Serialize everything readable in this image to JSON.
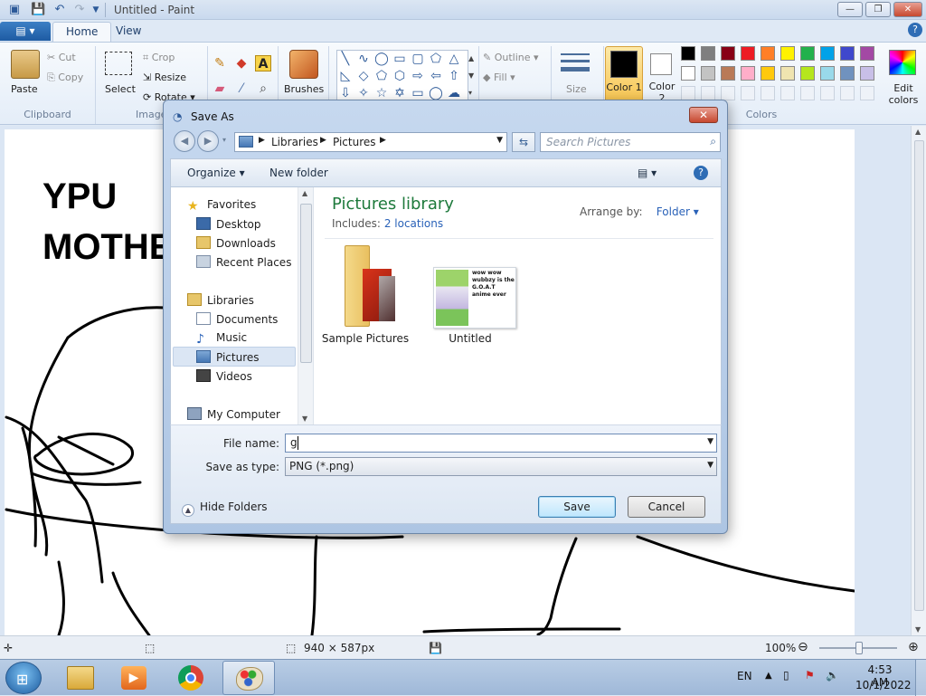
{
  "app": {
    "title": "Untitled - Paint",
    "tabs": {
      "file": "",
      "home": "Home",
      "view": "View"
    }
  },
  "ribbon": {
    "clipboard": {
      "paste": "Paste",
      "cut": "Cut",
      "copy": "Copy",
      "group": "Clipboard"
    },
    "image": {
      "select": "Select",
      "crop": "Crop",
      "resize": "Resize",
      "rotate": "Rotate",
      "group": "Image"
    },
    "tools": {
      "brushes": "Brushes"
    },
    "shapes": {
      "outline": "Outline",
      "fill": "Fill"
    },
    "size": "Size",
    "color1": "Color 1",
    "color2": "Color 2",
    "edit_colors": "Edit colors",
    "colors_group": "Colors",
    "palette_row1": [
      "#000000",
      "#7f7f7f",
      "#880015",
      "#ed1c24",
      "#ff7f27",
      "#fff200",
      "#22b14c",
      "#00a2e8",
      "#3f48cc",
      "#a349a4"
    ],
    "palette_row2": [
      "#ffffff",
      "#c3c3c3",
      "#b97a57",
      "#ffaec9",
      "#ffc90e",
      "#efe4b0",
      "#b5e61d",
      "#99d9ea",
      "#7092be",
      "#c8bfe7"
    ]
  },
  "canvas": {
    "text_line1": "YPU",
    "text_line2": "MOTHE"
  },
  "statusbar": {
    "dimensions": "940 × 587px",
    "zoom": "100%"
  },
  "dialog": {
    "title": "Save As",
    "breadcrumb": [
      "Libraries",
      "Pictures"
    ],
    "search_placeholder": "Search Pictures",
    "organize": "Organize",
    "new_folder": "New folder",
    "nav": {
      "favorites": "Favorites",
      "desktop": "Desktop",
      "downloads": "Downloads",
      "recent_places": "Recent Places",
      "libraries": "Libraries",
      "documents": "Documents",
      "music": "Music",
      "pictures": "Pictures",
      "videos": "Videos",
      "my_computer": "My Computer"
    },
    "library_title": "Pictures library",
    "includes_label": "Includes:",
    "includes_link": "2 locations",
    "arrange_by": "Arrange by:",
    "arrange_value": "Folder",
    "items": [
      {
        "label": "Sample Pictures"
      },
      {
        "label": "Untitled",
        "thumb_text": "wow wow wubbzy is the G.O.A.T anime ever"
      }
    ],
    "file_name_label": "File name:",
    "file_name_value": "g",
    "save_type_label": "Save as type:",
    "save_type_value": "PNG (*.png)",
    "hide_folders": "Hide Folders",
    "save_button": "Save",
    "cancel_button": "Cancel"
  },
  "taskbar": {
    "language": "EN",
    "time": "4:53 AM",
    "date": "10/1/2022"
  }
}
